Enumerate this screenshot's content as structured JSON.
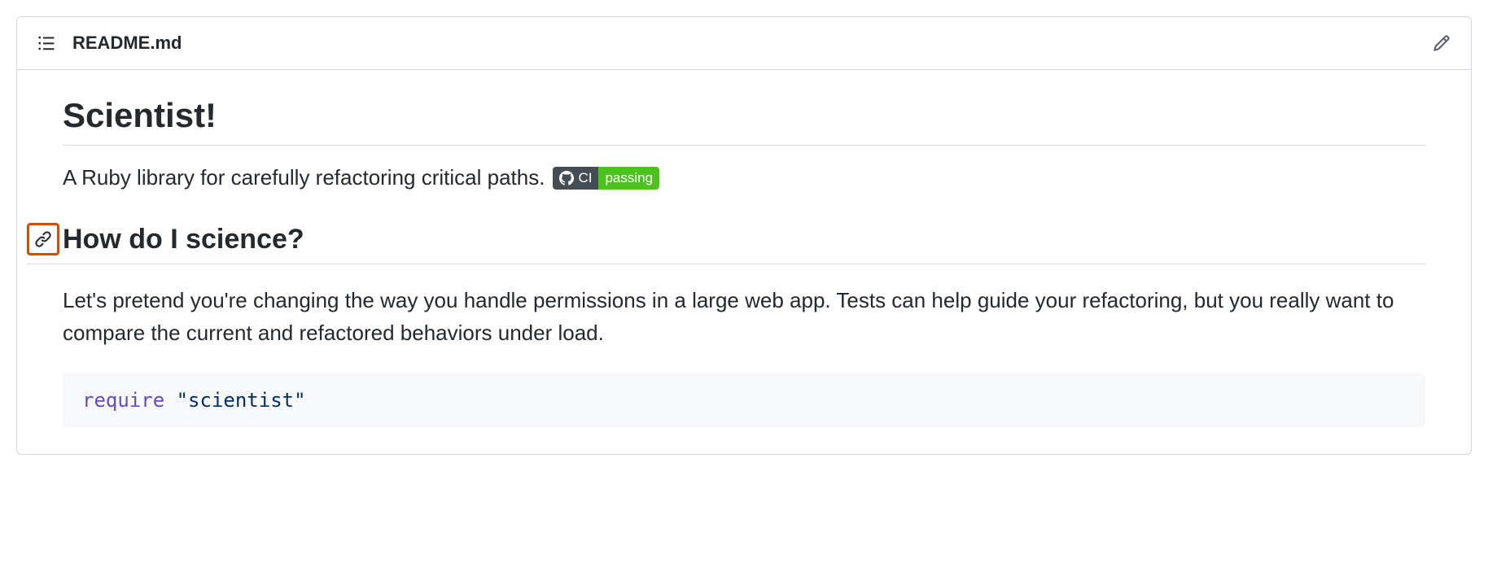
{
  "header": {
    "filename": "README.md"
  },
  "content": {
    "title": "Scientist!",
    "description": "A Ruby library for carefully refactoring critical paths.",
    "badge": {
      "label": "CI",
      "status": "passing"
    },
    "section_heading": "How do I science?",
    "paragraph": "Let's pretend you're changing the way you handle permissions in a large web app. Tests can help guide your refactoring, but you really want to compare the current and refactored behaviors under load.",
    "code": {
      "keyword": "require",
      "string": "\"scientist\""
    }
  }
}
